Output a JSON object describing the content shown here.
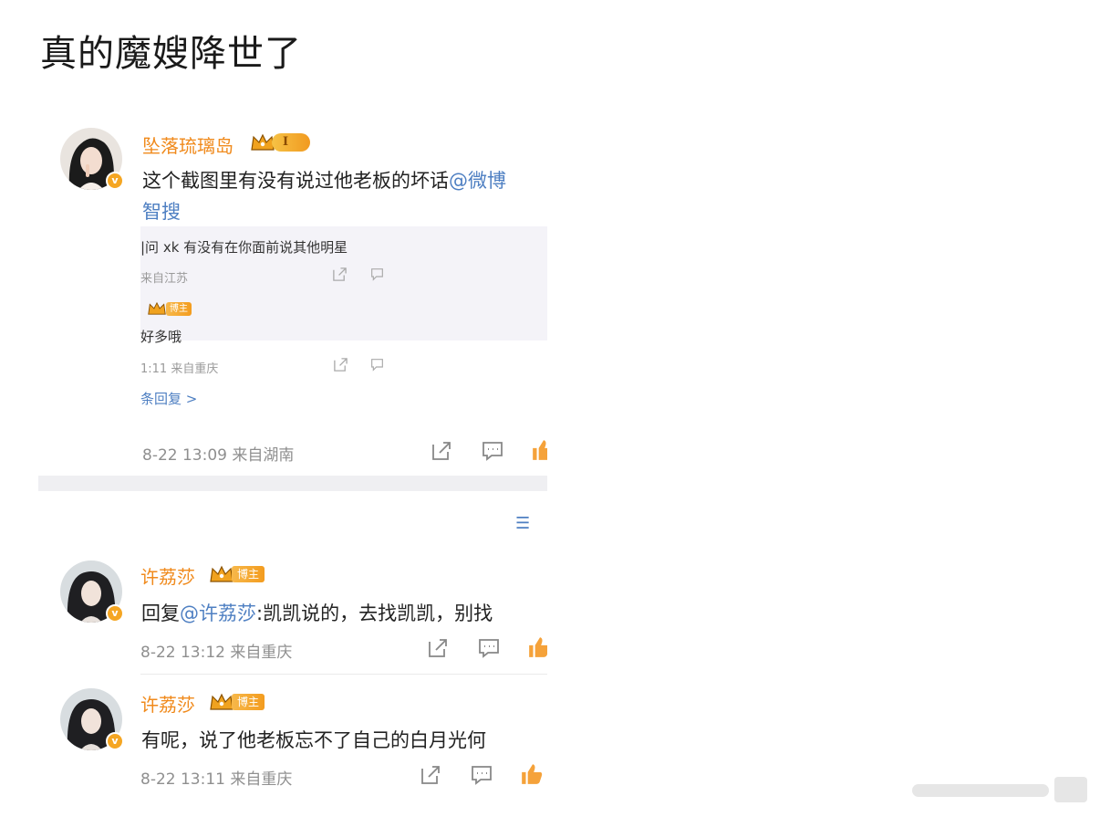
{
  "post": {
    "title": "真的魔嫂降世了"
  },
  "comment_main": {
    "username": "坠落琉璃岛",
    "level_badge": "I",
    "text": "这个截图里有没有说过他老板的坏话",
    "mention": "@微博",
    "mention_line2": "智搜",
    "quoted": {
      "reply1_text": "|问 xk 有没有在你面前说其他明星",
      "reply1_meta": "来自江苏",
      "reply2_badge": "博主",
      "reply2_text": "好多哦",
      "reply2_meta": "1:11 来自重庆",
      "more_replies": "条回复 >"
    },
    "time": "8-22 13:09 来自湖南"
  },
  "comment_2": {
    "username": "许荔莎",
    "badge": "博主",
    "reply_prefix": "回复",
    "mention": "@许荔莎",
    "text": ":凯凯说的，去找凯凯，别找",
    "time": "8-22 13:12 来自重庆"
  },
  "comment_3": {
    "username": "许荔莎",
    "badge": "博主",
    "text": "有呢，说了他老板忘不了自己的白月光何",
    "time": "8-22 13:11 来自重庆"
  },
  "icons": [
    "share-icon",
    "comment-icon",
    "like-icon",
    "sort-icon",
    "verified-badge-icon",
    "crown-icon"
  ],
  "colors": {
    "username": "#f08a1c",
    "mention": "#4e7fc2",
    "meta": "#8f8f8f",
    "badge": "#f39c1f"
  }
}
